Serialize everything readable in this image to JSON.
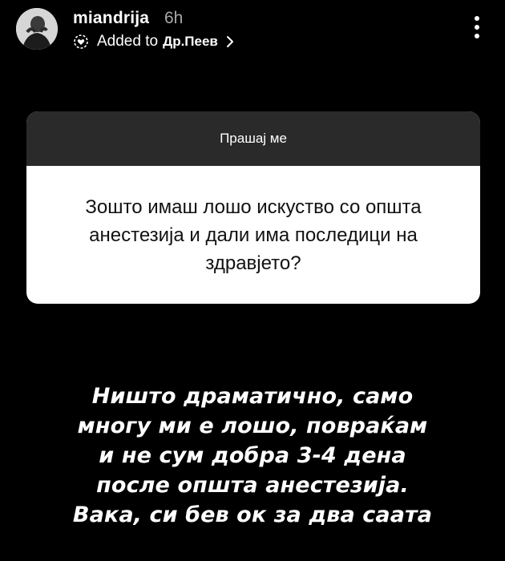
{
  "header": {
    "username": "miandrija",
    "time": "6h",
    "added_prefix": "Added to",
    "highlight_name": "Др.Пеев",
    "highlight_chevron": "›"
  },
  "question_card": {
    "title": "Прашај ме",
    "question": "Зошто имаш лошо искуство со општа анестезија и дали има последици на здравјето?"
  },
  "answer": {
    "lines": [
      "Ништо драматично, само",
      "многу ми е лошо, повраќам",
      "и не сум добра 3-4 дена",
      "после општа анестезија.",
      "Вака, си бев ок за два саата"
    ]
  },
  "colors": {
    "background": "#000000",
    "card_header": "#2a2a2a",
    "card_body": "#ffffff",
    "muted_text": "#a8a8a8"
  },
  "icons": {
    "avatar": "profile-photo",
    "highlight": "highlight-heart-circle-icon",
    "chevron": "chevron-right-icon",
    "more": "more-vertical-icon"
  }
}
